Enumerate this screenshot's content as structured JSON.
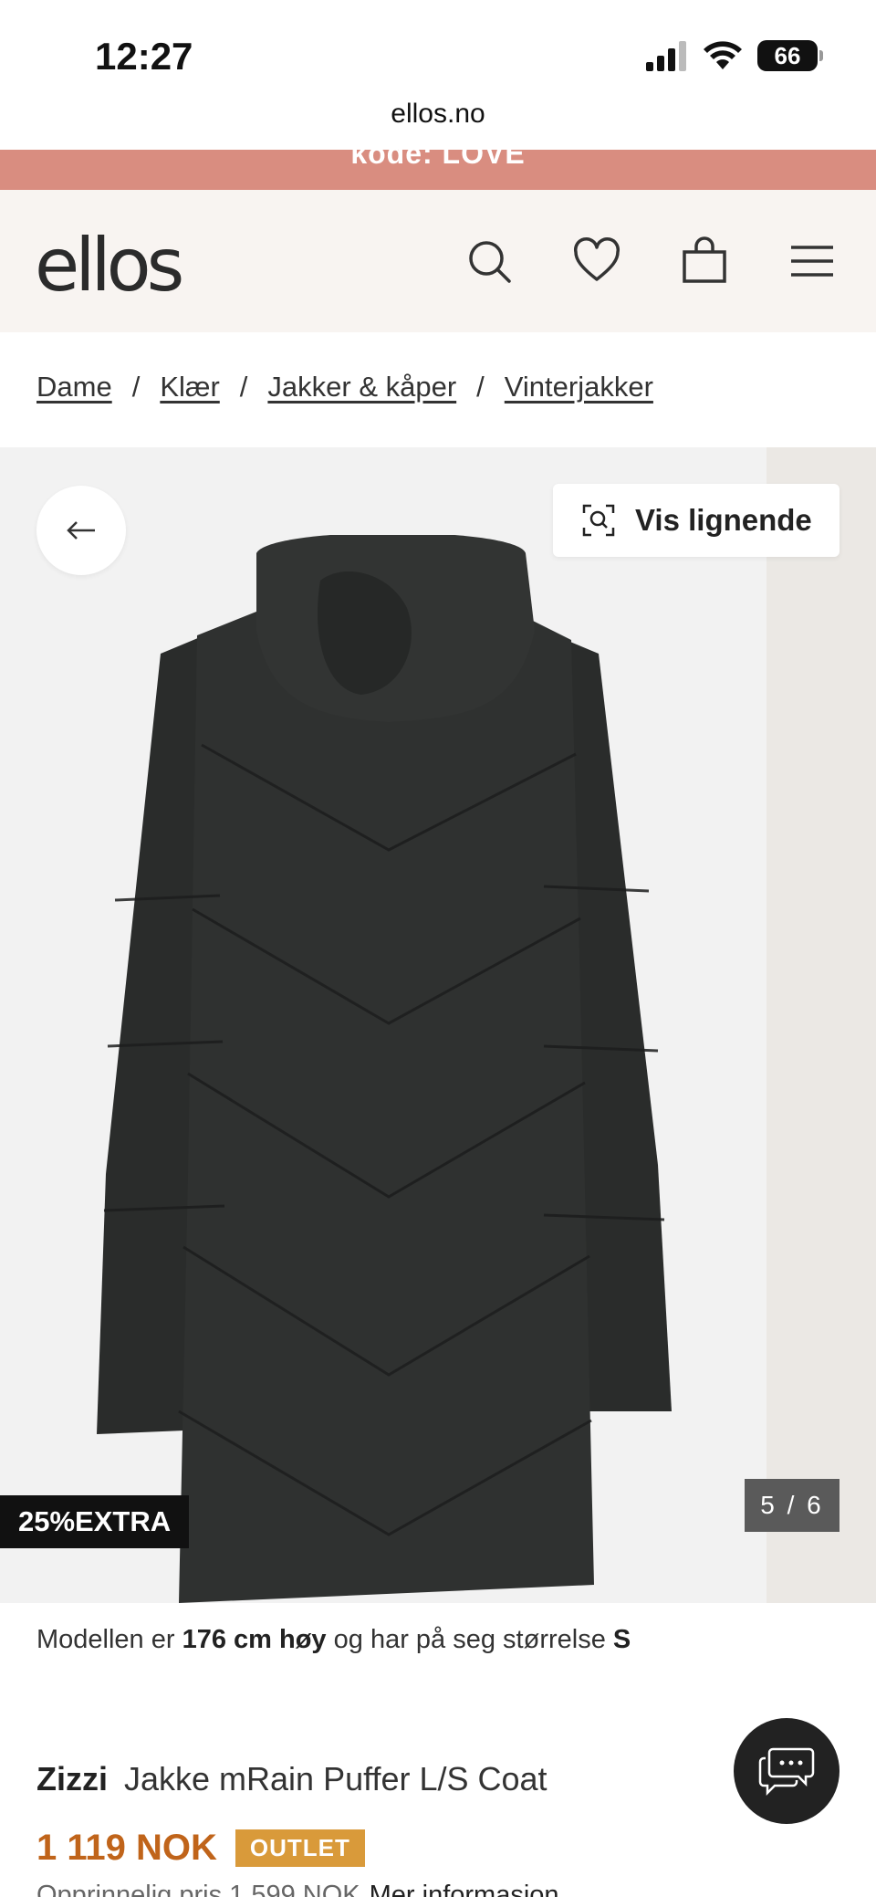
{
  "status_bar": {
    "time": "12:27",
    "battery": "66"
  },
  "browser": {
    "url": "ellos.no"
  },
  "promo": {
    "text": "kode: LOVE"
  },
  "header": {
    "logo": "ellos",
    "icons": [
      "search-icon",
      "heart-icon",
      "bag-icon",
      "menu-icon"
    ]
  },
  "breadcrumb": [
    {
      "label": "Dame"
    },
    {
      "label": "Klær"
    },
    {
      "label": "Jakker & kåper"
    },
    {
      "label": "Vinterjakker"
    }
  ],
  "breadcrumb_separator": "/",
  "gallery": {
    "similar_label": "Vis lignende",
    "discount_tag": "25%EXTRA",
    "pager": "5 / 6"
  },
  "model_info": {
    "prefix": "Modellen er ",
    "height": "176 cm høy",
    "middle": " og har på seg størrelse ",
    "size": "S"
  },
  "product": {
    "brand": "Zizzi",
    "name": "Jakke mRain Puffer L/S Coat",
    "price": "1 119 NOK",
    "badge": "OUTLET",
    "original_price": "Opprinnelig pris 1 599 NOK",
    "more_info": "Mer informasjon"
  },
  "colors": {
    "promo": "#d98d80",
    "header_bg": "#f8f4f1",
    "price": "#c0641a",
    "badge": "#d99a3a"
  }
}
